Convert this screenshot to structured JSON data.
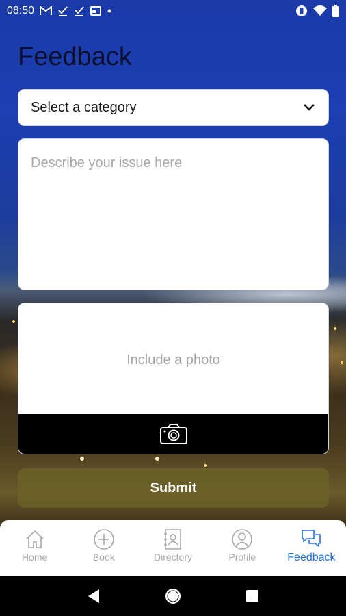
{
  "status_bar": {
    "time": "08:50",
    "left_icons": [
      "gmail-icon",
      "check-download-icon",
      "check-download-icon",
      "calendar-icon",
      "dot-icon"
    ],
    "right_icons": [
      "vibrate-icon",
      "wifi-icon",
      "battery-icon"
    ]
  },
  "page": {
    "title": "Feedback"
  },
  "form": {
    "category_select": {
      "value": "Select a category",
      "icon": "chevron-down-icon"
    },
    "description": {
      "placeholder": "Describe your issue here"
    },
    "photo": {
      "label": "Include a photo",
      "icon": "camera-icon"
    },
    "submit_label": "Submit"
  },
  "tab_bar": {
    "active_color": "#1e6fe0",
    "inactive_color": "#a9a9a9",
    "tabs": [
      {
        "label": "Home",
        "icon": "home-icon",
        "active": false
      },
      {
        "label": "Book",
        "icon": "plus-circle-icon",
        "active": false
      },
      {
        "label": "Directory",
        "icon": "contacts-book-icon",
        "active": false
      },
      {
        "label": "Profile",
        "icon": "user-circle-icon",
        "active": false
      },
      {
        "label": "Feedback",
        "icon": "chat-bubbles-icon",
        "active": true
      }
    ]
  },
  "nav_bar": {
    "icons": [
      "back-icon",
      "home-button-icon",
      "recents-icon"
    ]
  }
}
